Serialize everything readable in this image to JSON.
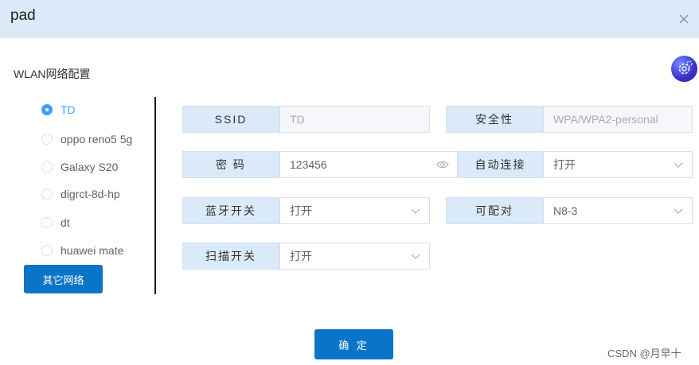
{
  "dialog": {
    "title": "pad",
    "close_icon": "close-icon"
  },
  "section": {
    "title": "WLAN网络配置",
    "settings_icon": "gear-icon"
  },
  "networks": {
    "items": [
      {
        "label": "TD",
        "selected": true
      },
      {
        "label": "oppo reno5 5g",
        "selected": false
      },
      {
        "label": "Galaxy S20",
        "selected": false
      },
      {
        "label": "digrct-8d-hp",
        "selected": false
      },
      {
        "label": "dt",
        "selected": false
      },
      {
        "label": "huawei mate",
        "selected": false
      }
    ],
    "other_button": "其它网络"
  },
  "form": {
    "ssid": {
      "label": "SSID",
      "value": "TD"
    },
    "security": {
      "label": "安全性",
      "value": "WPA/WPA2-personal"
    },
    "password": {
      "label": "密 码",
      "value": "123456"
    },
    "auto_connect": {
      "label": "自动连接",
      "value": "打开"
    },
    "bluetooth": {
      "label": "蓝牙开关",
      "value": "打开"
    },
    "pairable": {
      "label": "可配对",
      "value": "N8-3"
    },
    "scan": {
      "label": "扫描开关",
      "value": "打开"
    }
  },
  "footer": {
    "confirm_button": "确 定"
  },
  "watermark": "CSDN @月早十",
  "colors": {
    "header_bg": "#dbe9f8",
    "primary": "#0a74c9",
    "selected": "#409eff",
    "label_bg": "#dbeaf8"
  }
}
